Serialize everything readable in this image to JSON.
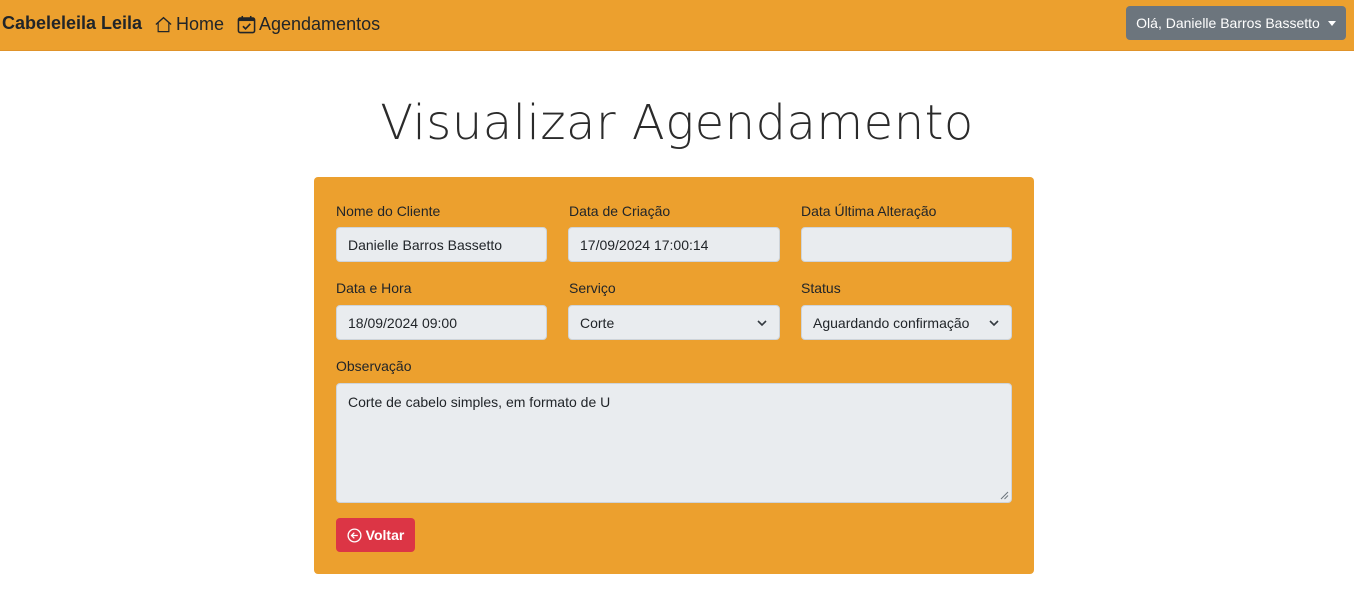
{
  "navbar": {
    "brand": "Cabeleleila Leila",
    "links": [
      {
        "label": "Home",
        "icon": "home-icon"
      },
      {
        "label": "Agendamentos",
        "icon": "calendar-check-icon"
      }
    ],
    "user_menu_label": "Olá, Danielle Barros Bassetto",
    "background_color": "#eca02e"
  },
  "page": {
    "title": "Visualizar Agendamento"
  },
  "form": {
    "client_name": {
      "label": "Nome do Cliente",
      "value": "Danielle Barros Bassetto"
    },
    "created_at": {
      "label": "Data de Criação",
      "value": "17/09/2024 17:00:14"
    },
    "last_modified": {
      "label": "Data Última Alteração",
      "value": ""
    },
    "datetime": {
      "label": "Data e Hora",
      "value": "18/09/2024 09:00"
    },
    "service": {
      "label": "Serviço",
      "value": "Corte"
    },
    "status": {
      "label": "Status",
      "value": "Aguardando confirmação"
    },
    "notes": {
      "label": "Observação",
      "value": "Corte de cabelo simples, em formato de U"
    },
    "back_button": {
      "label": "Voltar",
      "icon": "arrow-left-circle-icon",
      "color": "#dc3545"
    }
  }
}
